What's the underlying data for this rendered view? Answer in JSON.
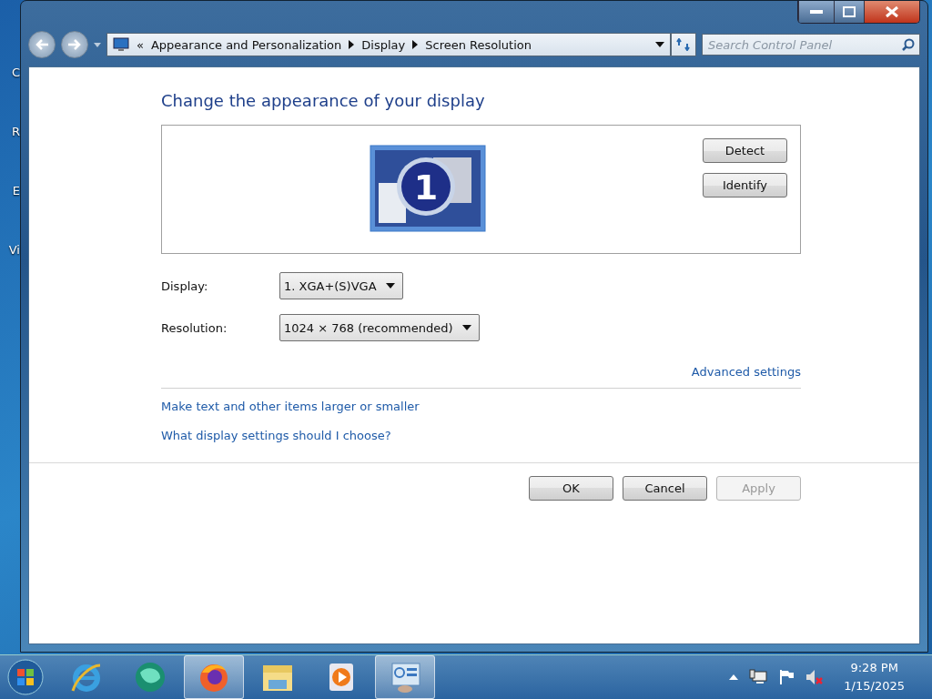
{
  "desktop": {
    "labels": [
      "C",
      "R",
      "E",
      "Vi"
    ]
  },
  "window": {
    "address_bar": {
      "overflow": "«",
      "breadcrumbs": [
        "Appearance and Personalization",
        "Display",
        "Screen Resolution"
      ]
    },
    "search": {
      "placeholder": "Search Control Panel"
    }
  },
  "heading": "Change the appearance of your display",
  "monitor_preview": {
    "number": "1",
    "buttons": [
      "Detect",
      "Identify"
    ]
  },
  "fields": [
    {
      "label": "Display:",
      "value": "1. XGA+(S)VGA"
    },
    {
      "label": "Resolution:",
      "value": "1024 × 768 (recommended)"
    }
  ],
  "advanced_link": "Advanced settings",
  "links": [
    "Make text and other items larger or smaller",
    "What display settings should I choose?"
  ],
  "buttons": [
    {
      "label": "OK",
      "disabled": false
    },
    {
      "label": "Cancel",
      "disabled": false
    },
    {
      "label": "Apply",
      "disabled": true
    }
  ],
  "taskbar": {
    "apps": [
      {
        "kind": "ie",
        "active": false
      },
      {
        "kind": "chat",
        "active": false
      },
      {
        "kind": "firefox",
        "active": true
      },
      {
        "kind": "folder",
        "active": false
      },
      {
        "kind": "media",
        "active": false
      },
      {
        "kind": "control",
        "active": true
      }
    ],
    "clock": {
      "time": "9:28 PM",
      "date": "1/15/2025"
    }
  }
}
